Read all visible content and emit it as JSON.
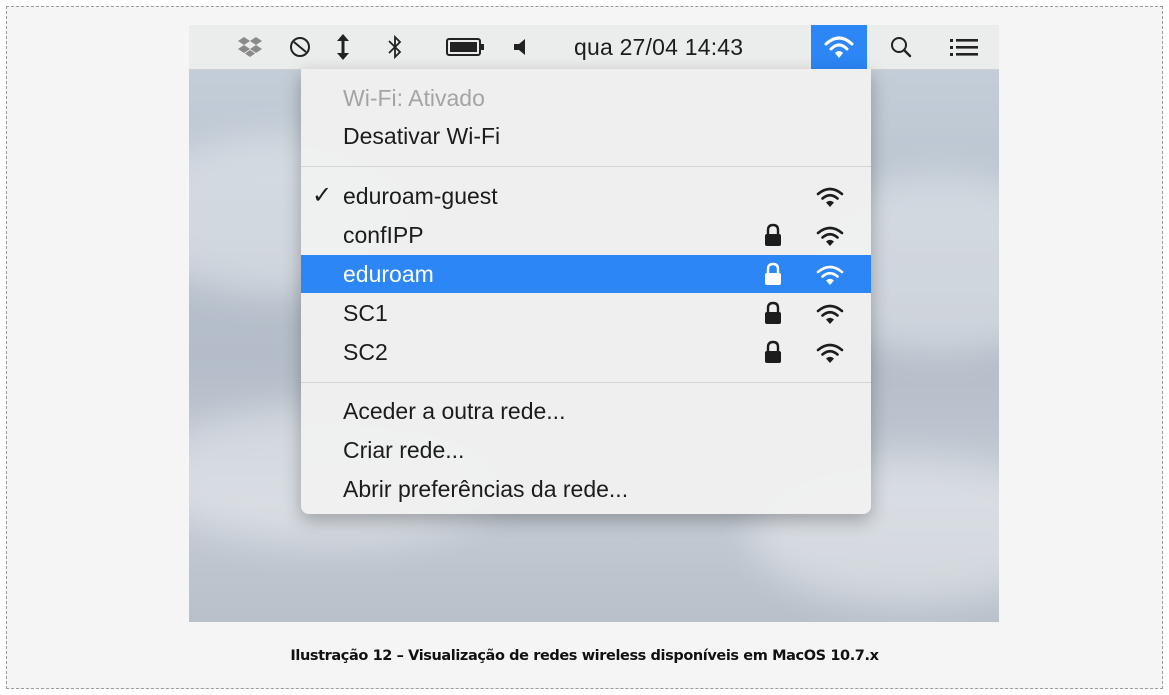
{
  "menubar": {
    "icons": [
      "dropbox-icon",
      "do-not-disturb-icon",
      "sync-arrows-icon",
      "bluetooth-icon",
      "battery-icon",
      "volume-icon",
      "wifi-icon",
      "search-icon",
      "list-icon"
    ],
    "clock": "qua 27/04  14:43"
  },
  "wifi_menu": {
    "status": "Wi-Fi: Ativado",
    "toggle": "Desativar Wi-Fi",
    "networks": [
      {
        "name": "eduroam-guest",
        "connected": true,
        "secured": false,
        "signal": 3
      },
      {
        "name": "confIPP",
        "connected": false,
        "secured": true,
        "signal": 3
      },
      {
        "name": "eduroam",
        "connected": false,
        "secured": true,
        "signal": 3,
        "highlighted": true
      },
      {
        "name": "SC1",
        "connected": false,
        "secured": true,
        "signal": 3
      },
      {
        "name": "SC2",
        "connected": false,
        "secured": true,
        "signal": 3
      }
    ],
    "checkmark": "✓",
    "actions": [
      "Aceder a outra rede...",
      "Criar rede...",
      "Abrir preferências da rede..."
    ]
  },
  "colors": {
    "accent": "#2c86f5"
  },
  "caption": "Ilustração 12 – Visualização de redes wireless disponíveis em MacOS 10.7.x"
}
